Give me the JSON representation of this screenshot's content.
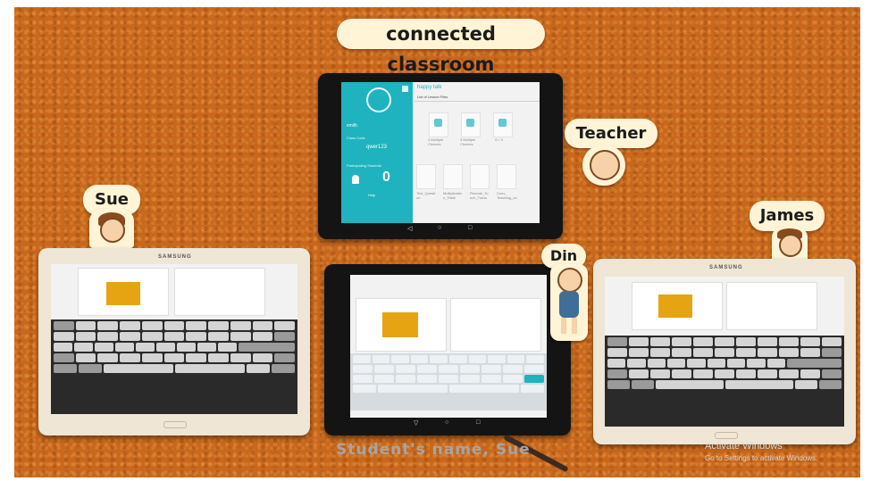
{
  "scene": {
    "title": "connected classroom",
    "subtitle": "Student's name, Sue",
    "watermark_line1": "Activate Windows",
    "watermark_line2": "Go to Settings to activate Windows.",
    "background_color": "#c9681c"
  },
  "characters": {
    "teacher": "Teacher",
    "sue": "Sue",
    "james": "James",
    "din": "Din"
  },
  "tablets": {
    "samsung_brand": "SAMSUNG",
    "teacher": {
      "app_title": "happy talk",
      "tab_label": "List of Lesson Files",
      "username": "smith",
      "class_code_label": "Class Code",
      "class_code": "qwer123",
      "participating_label": "Participating Students",
      "participating_count": "0",
      "help_label": "Help",
      "tiles_row1": [
        "4 Multiple Choices",
        "3 Multiple Choices",
        "O / X"
      ],
      "tiles_row2": [
        "Test_Questi on",
        "Multiplicatio n_Table",
        "Remote_To uch_Trans",
        "Conv_ Teaching_on"
      ]
    }
  }
}
